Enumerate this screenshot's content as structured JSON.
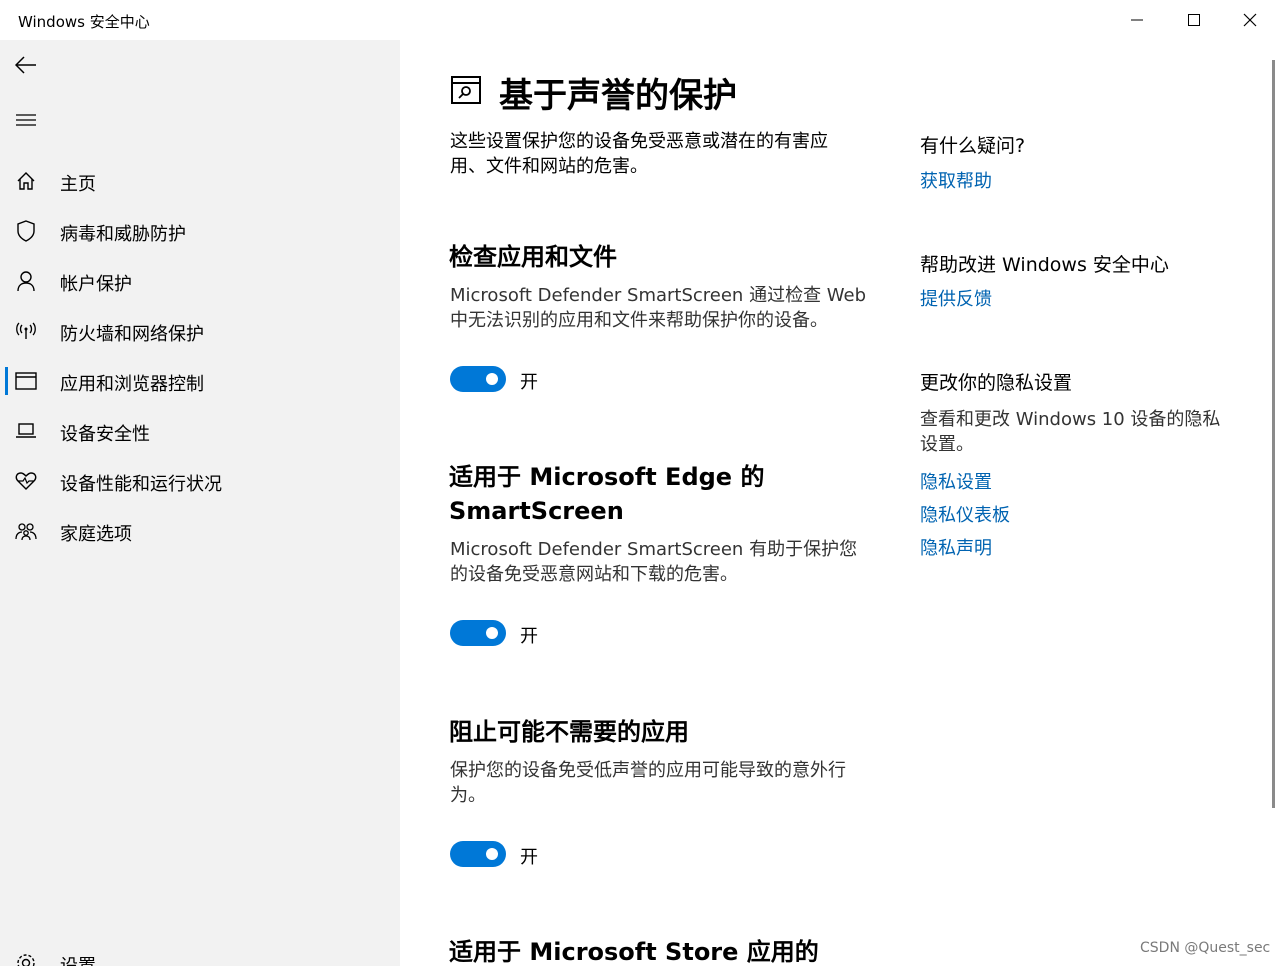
{
  "window": {
    "title": "Windows 安全中心",
    "minimize_icon": "minimize-icon",
    "maximize_icon": "maximize-icon",
    "close_icon": "close-icon"
  },
  "sidebar": {
    "items": [
      {
        "label": "主页",
        "icon": "home-icon"
      },
      {
        "label": "病毒和威胁防护",
        "icon": "shield-icon"
      },
      {
        "label": "帐户保护",
        "icon": "person-icon"
      },
      {
        "label": "防火墙和网络保护",
        "icon": "wifi-antenna-icon"
      },
      {
        "label": "应用和浏览器控制",
        "icon": "app-browser-icon",
        "selected": true
      },
      {
        "label": "设备安全性",
        "icon": "laptop-icon"
      },
      {
        "label": "设备性能和运行状况",
        "icon": "heart-pulse-icon"
      },
      {
        "label": "家庭选项",
        "icon": "family-icon"
      }
    ],
    "settings_label": "设置",
    "accent_color": "#0078d7"
  },
  "main": {
    "title": "基于声誉的保护",
    "intro": "这些设置保护您的设备免受恶意或潜在的有害应用、文件和网站的危害。",
    "sections": [
      {
        "heading": "检查应用和文件",
        "description": "Microsoft Defender SmartScreen 通过检查 Web 中无法识别的应用和文件来帮助保护你的设备。",
        "toggle_state": "开",
        "toggle_on": true
      },
      {
        "heading": "适用于 Microsoft Edge 的 SmartScreen",
        "description": "Microsoft Defender SmartScreen 有助于保护您的设备免受恶意网站和下载的危害。",
        "toggle_state": "开",
        "toggle_on": true
      },
      {
        "heading": "阻止可能不需要的应用",
        "description": "保护您的设备免受低声誉的应用可能导致的意外行为。",
        "toggle_state": "开",
        "toggle_on": true
      },
      {
        "heading": "适用于 Microsoft Store 应用的"
      }
    ]
  },
  "side": {
    "question_heading": "有什么疑问?",
    "help_link": "获取帮助",
    "improve_heading": "帮助改进 Windows 安全中心",
    "feedback_link": "提供反馈",
    "privacy_heading": "更改你的隐私设置",
    "privacy_text": "查看和更改 Windows 10 设备的隐私设置。",
    "privacy_links": [
      "隐私设置",
      "隐私仪表板",
      "隐私声明"
    ],
    "link_color": "#0063b1"
  },
  "watermark": "CSDN @Quest_sec"
}
